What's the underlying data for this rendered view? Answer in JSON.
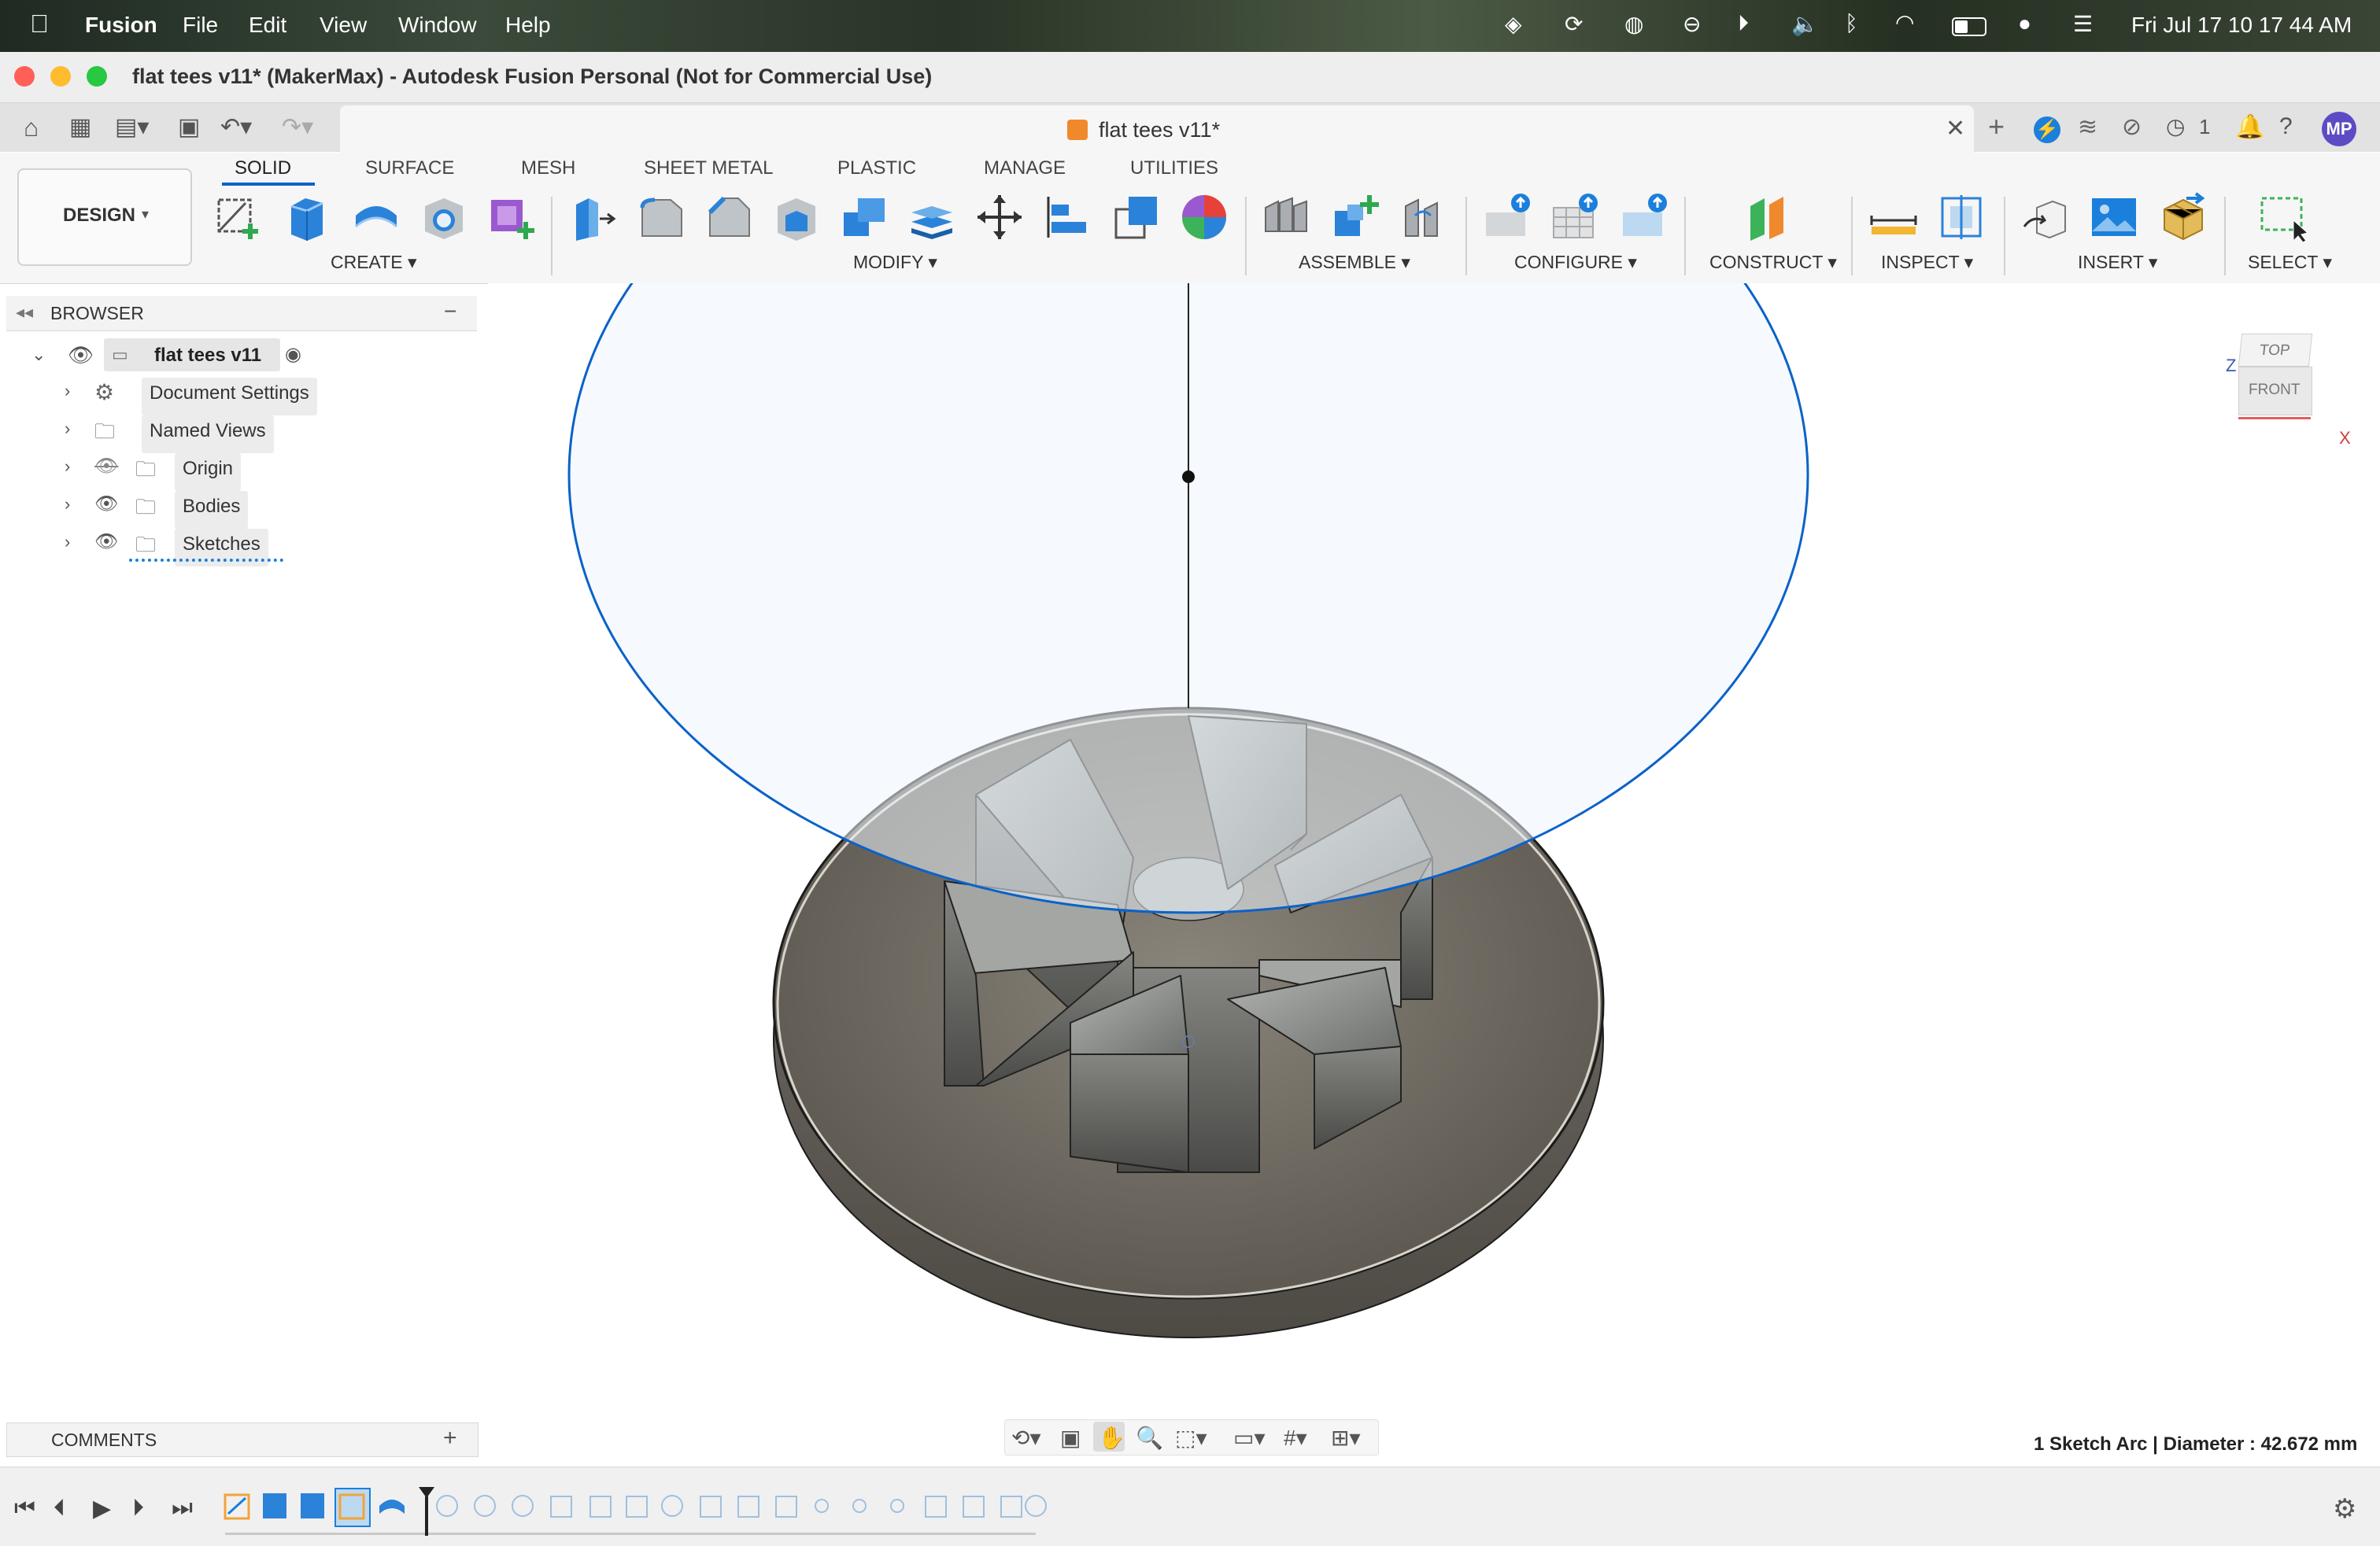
{
  "menubar": {
    "app_name": "Fusion",
    "items": [
      "File",
      "Edit",
      "View",
      "Window",
      "Help"
    ],
    "clock": "Fri Jul 17  10 17 44 AM"
  },
  "window": {
    "title": "flat tees v11* (MakerMax) - Autodesk Fusion Personal (Not for Commercial Use)"
  },
  "tabs": {
    "doc_tab_label": "flat tees v11*",
    "job_count": "1",
    "user_initials": "MP"
  },
  "toolbar": {
    "workspace": "DESIGN",
    "tabs": [
      "SOLID",
      "SURFACE",
      "MESH",
      "SHEET METAL",
      "PLASTIC",
      "MANAGE",
      "UTILITIES"
    ],
    "active_tab": "SOLID",
    "groups": {
      "create": "CREATE",
      "modify": "MODIFY",
      "assemble": "ASSEMBLE",
      "configure": "CONFIGURE",
      "construct": "CONSTRUCT",
      "inspect": "INSPECT",
      "insert": "INSERT",
      "select": "SELECT"
    }
  },
  "browser": {
    "title": "BROWSER",
    "root": "flat tees v11",
    "items": [
      {
        "label": "Document Settings",
        "icon": "gear-icon"
      },
      {
        "label": "Named Views",
        "icon": "folder-icon"
      },
      {
        "label": "Origin",
        "icon": "folder-icon",
        "visibility": "hidden"
      },
      {
        "label": "Bodies",
        "icon": "folder-icon",
        "visibility": "visible"
      },
      {
        "label": "Sketches",
        "icon": "folder-icon",
        "visibility": "visible"
      }
    ]
  },
  "comments": {
    "title": "COMMENTS"
  },
  "viewcube": {
    "top": "TOP",
    "front": "FRONT",
    "axis_z": "Z",
    "axis_x": "X"
  },
  "status": {
    "selection_info": "1 Sketch Arc | Diameter : 42.672 mm"
  },
  "colors": {
    "accent": "#0b62c8",
    "sketch_fill": "#eef5fd",
    "body_dark": "#5e5a52",
    "body_light": "#a7a9a6",
    "user_avatar": "#5b4bc4"
  }
}
